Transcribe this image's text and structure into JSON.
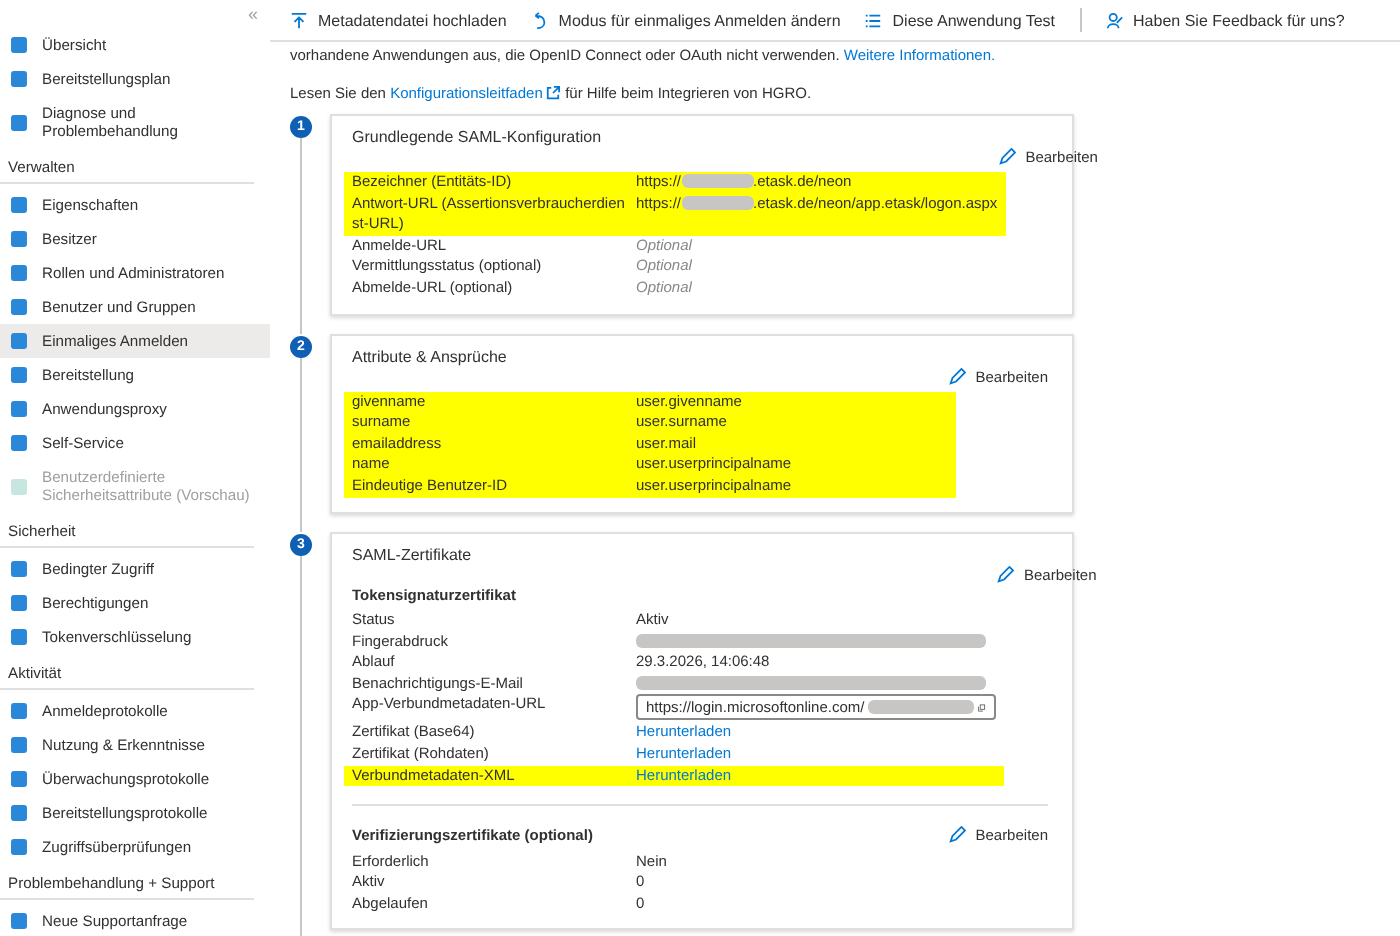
{
  "sidebar": {
    "collapse_glyph": "«",
    "sections": [
      {
        "items": [
          {
            "label": "Übersicht",
            "selected": false,
            "disabled": false
          },
          {
            "label": "Bereitstellungsplan",
            "selected": false,
            "disabled": false
          },
          {
            "label": "Diagnose und Problembehandlung",
            "selected": false,
            "disabled": false
          }
        ]
      },
      {
        "heading": "Verwalten",
        "items": [
          {
            "label": "Eigenschaften",
            "selected": false,
            "disabled": false
          },
          {
            "label": "Besitzer",
            "selected": false,
            "disabled": false
          },
          {
            "label": "Rollen und Administratoren",
            "selected": false,
            "disabled": false
          },
          {
            "label": "Benutzer und Gruppen",
            "selected": false,
            "disabled": false
          },
          {
            "label": "Einmaliges Anmelden",
            "selected": true,
            "disabled": false
          },
          {
            "label": "Bereitstellung",
            "selected": false,
            "disabled": false
          },
          {
            "label": "Anwendungsproxy",
            "selected": false,
            "disabled": false
          },
          {
            "label": "Self-Service",
            "selected": false,
            "disabled": false
          },
          {
            "label": "Benutzerdefinierte Sicherheitsattribute (Vorschau)",
            "selected": false,
            "disabled": true
          }
        ]
      },
      {
        "heading": "Sicherheit",
        "items": [
          {
            "label": "Bedingter Zugriff",
            "selected": false,
            "disabled": false
          },
          {
            "label": "Berechtigungen",
            "selected": false,
            "disabled": false
          },
          {
            "label": "Tokenverschlüsselung",
            "selected": false,
            "disabled": false
          }
        ]
      },
      {
        "heading": "Aktivität",
        "items": [
          {
            "label": "Anmeldeprotokolle",
            "selected": false,
            "disabled": false
          },
          {
            "label": "Nutzung & Erkenntnisse",
            "selected": false,
            "disabled": false
          },
          {
            "label": "Überwachungsprotokolle",
            "selected": false,
            "disabled": false
          },
          {
            "label": "Bereitstellungsprotokolle",
            "selected": false,
            "disabled": false
          },
          {
            "label": "Zugriffsüberprüfungen",
            "selected": false,
            "disabled": false
          }
        ]
      },
      {
        "heading": "Problembehandlung + Support",
        "items": [
          {
            "label": "Neue Supportanfrage",
            "selected": false,
            "disabled": false
          }
        ]
      }
    ]
  },
  "toolbar": [
    {
      "label": "Metadatendatei hochladen",
      "kind": "upload"
    },
    {
      "label": "Modus für einmaliges Anmelden ändern",
      "kind": "undo"
    },
    {
      "label": "Diese Anwendung Test",
      "kind": "list"
    },
    {
      "kind": "separator"
    },
    {
      "label": "Haben Sie Feedback für uns?",
      "kind": "feedback"
    }
  ],
  "intro": {
    "text": "vorhandene Anwendungen aus, die OpenID Connect oder OAuth nicht verwenden.",
    "link": "Weitere Informationen."
  },
  "guide": {
    "before": "Lesen Sie den",
    "link": "Konfigurationsleitfaden",
    "after": "für Hilfe beim Integrieren von HGRO."
  },
  "steps": [
    {
      "number": "1",
      "title": "Grundlegende SAML-Konfiguration",
      "subsections": [
        {
          "edit_label": "Bearbeiten",
          "rows": [
            {
              "label": "Bezeichner (Entitäts-ID)",
              "kind": "redacted_url",
              "value": "https://",
              "value_end": ".etask.de/neon",
              "highlighted": true
            },
            {
              "label": "Antwort-URL (Assertionsverbraucherdienst-URL)",
              "kind": "redacted_url",
              "value": "https://",
              "value_end": ".etask.de/neon/app.etask/logon.aspx",
              "highlighted": true
            },
            {
              "label": "Anmelde-URL",
              "kind": "optional",
              "value": "Optional",
              "highlighted": false
            },
            {
              "label": "Vermittlungsstatus (optional)",
              "kind": "optional",
              "value": "Optional",
              "highlighted": false
            },
            {
              "label": "Abmelde-URL (optional)",
              "kind": "optional",
              "value": "Optional",
              "highlighted": false
            }
          ]
        }
      ]
    },
    {
      "number": "2",
      "title": "Attribute & Ansprüche",
      "subsections": [
        {
          "edit_label": "Bearbeiten",
          "rows": [
            {
              "label": "givenname",
              "kind": "text",
              "value": "user.givenname",
              "highlighted": true
            },
            {
              "label": "surname",
              "kind": "text",
              "value": "user.surname",
              "highlighted": true
            },
            {
              "label": "emailaddress",
              "kind": "text",
              "value": "user.mail",
              "highlighted": true
            },
            {
              "label": "name",
              "kind": "text",
              "value": "user.userprincipalname",
              "highlighted": true
            },
            {
              "label": "Eindeutige Benutzer-ID",
              "kind": "text",
              "value": "user.userprincipalname",
              "highlighted": true
            }
          ]
        }
      ]
    },
    {
      "number": "3",
      "title": "SAML-Zertifikate",
      "subsections": [
        {
          "heading": "Tokensignaturzertifikat",
          "edit_label": "Bearbeiten",
          "rows": [
            {
              "label": "Status",
              "kind": "text",
              "value": "Aktiv",
              "highlighted": false
            },
            {
              "label": "Fingerabdruck",
              "kind": "redacted",
              "highlighted": false
            },
            {
              "label": "Ablauf",
              "kind": "text",
              "value": "29.3.2026, 14:06:48",
              "highlighted": false
            },
            {
              "label": "Benachrichtigungs-E-Mail",
              "kind": "redacted",
              "highlighted": false
            },
            {
              "label": "App-Verbundmetadaten-URL",
              "kind": "url_field",
              "value": "https://login.microsoftonline.com/",
              "highlighted": false
            },
            {
              "label": "Zertifikat (Base64)",
              "kind": "link",
              "value": "Herunterladen",
              "highlighted": false
            },
            {
              "label": "Zertifikat (Rohdaten)",
              "kind": "link",
              "value": "Herunterladen",
              "highlighted": false
            },
            {
              "label": "Verbundmetadaten-XML",
              "kind": "link",
              "value": "Herunterladen",
              "highlighted": true
            }
          ]
        },
        {
          "heading": "Verifizierungszertifikate (optional)",
          "edit_label": "Bearbeiten",
          "rows": [
            {
              "label": "Erforderlich",
              "kind": "text",
              "value": "Nein",
              "highlighted": false
            },
            {
              "label": "Aktiv",
              "kind": "text",
              "value": "0",
              "highlighted": false
            },
            {
              "label": "Abgelaufen",
              "kind": "text",
              "value": "0",
              "highlighted": false
            }
          ]
        }
      ]
    }
  ]
}
